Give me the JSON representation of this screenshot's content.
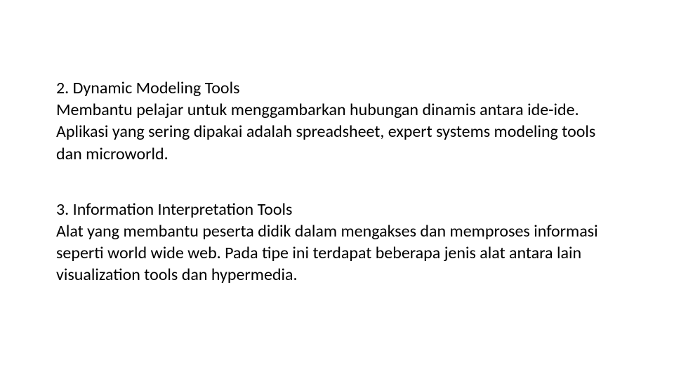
{
  "sections": [
    {
      "title": "2. Dynamic Modeling Tools",
      "body": "Membantu pelajar untuk menggambarkan hubungan dinamis antara ide-ide. Aplikasi yang sering dipakai adalah spreadsheet, expert systems modeling tools dan microworld."
    },
    {
      "title": "3. Information Interpretation Tools",
      "body": "Alat yang membantu peserta didik dalam mengakses dan memproses informasi seperti world wide web. Pada tipe ini terdapat beberapa jenis alat antara lain visualization tools dan hypermedia."
    }
  ]
}
